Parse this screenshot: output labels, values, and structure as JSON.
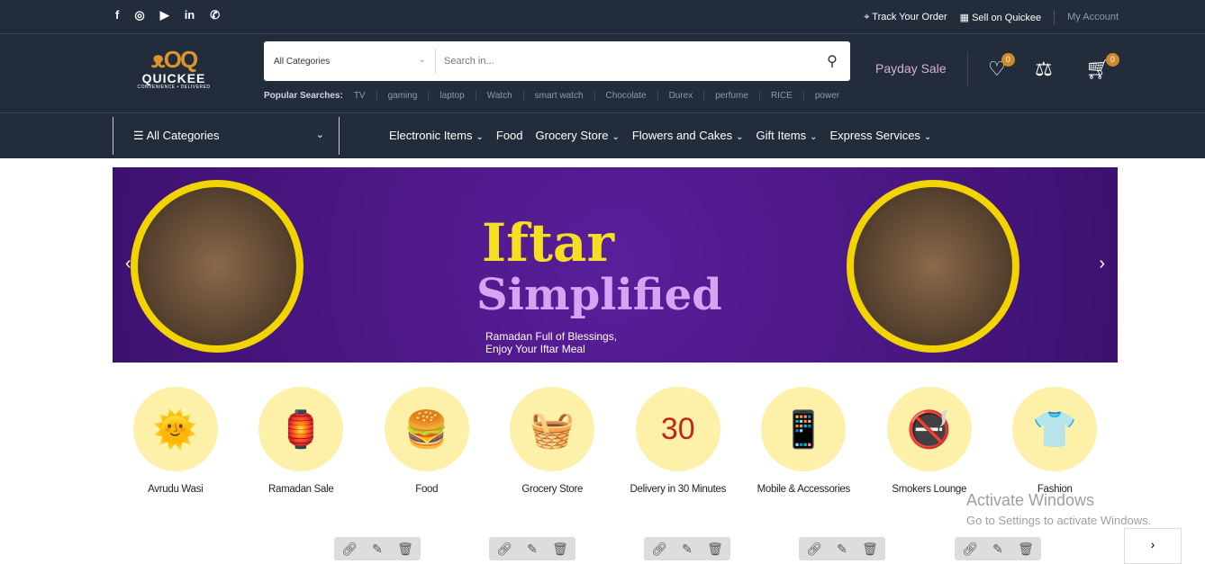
{
  "topbar": {
    "social": [
      "f",
      "◎",
      "▶",
      "in",
      "✆"
    ],
    "track": "Track Your Order",
    "sell": "Sell on Quickee",
    "account": "My Account"
  },
  "logo": {
    "name": "QUICKEE",
    "tagline": "CONVENIENCE • DELIVERED"
  },
  "search": {
    "category": "All Categories",
    "placeholder": "Search in..."
  },
  "popular": {
    "label": "Popular Searches:",
    "items": [
      "TV",
      "gaming",
      "laptop",
      "Watch",
      "smart watch",
      "Chocolate",
      "Durex",
      "perfume",
      "RICE",
      "power"
    ]
  },
  "header": {
    "payday": "Payday Sale",
    "wishlist_count": "0",
    "cart_count": "0"
  },
  "nav": {
    "all_categories": "All Categories",
    "items": [
      "Electronic Items",
      "Food",
      "Grocery Store",
      "Flowers and Cakes",
      "Gift Items",
      "Express Services"
    ]
  },
  "banner": {
    "title": "Iftar",
    "subtitle": "Simplified",
    "line1": "Ramadan Full of Blessings,",
    "line2": "Enjoy Your Iftar Meal"
  },
  "categories": [
    {
      "label": "Avrudu Wasi",
      "icon": "🌞"
    },
    {
      "label": "Ramadan Sale",
      "icon": "🏮"
    },
    {
      "label": "Food",
      "icon": "🍔"
    },
    {
      "label": "Grocery Store",
      "icon": "🧺"
    },
    {
      "label": "Delivery in 30 Minutes",
      "icon": "30"
    },
    {
      "label": "Mobile & Accessories",
      "icon": "📱"
    },
    {
      "label": "Smokers Lounge",
      "icon": "🚭"
    },
    {
      "label": "Fashion",
      "icon": "👕"
    }
  ],
  "watermark": {
    "title": "Activate Windows",
    "subtitle": "Go to Settings to activate Windows."
  }
}
